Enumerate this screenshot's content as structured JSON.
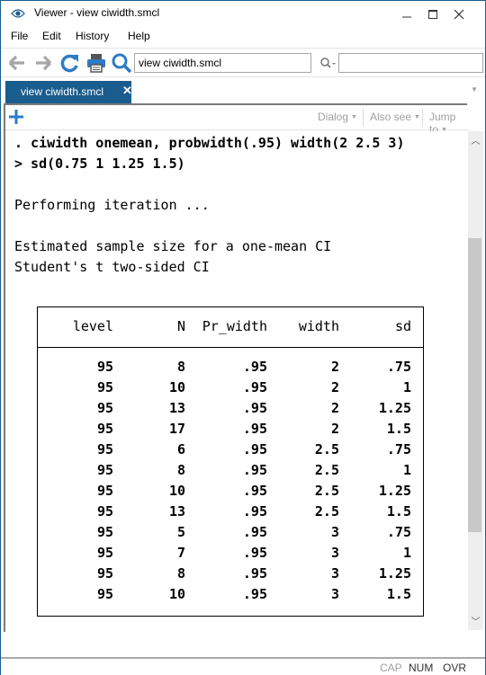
{
  "window": {
    "title": "Viewer - view ciwidth.smcl",
    "app_icon": "eye-icon",
    "controls": [
      "minimize",
      "maximize",
      "close"
    ]
  },
  "menu": {
    "items": [
      "File",
      "Edit",
      "History",
      "Help"
    ]
  },
  "toolbar": {
    "buttons": [
      {
        "name": "back",
        "icon": "arrow-left-icon",
        "enabled": false
      },
      {
        "name": "forward",
        "icon": "arrow-right-icon",
        "enabled": false
      },
      {
        "name": "refresh",
        "icon": "refresh-icon",
        "enabled": true
      },
      {
        "name": "print",
        "icon": "printer-icon",
        "enabled": true
      },
      {
        "name": "search",
        "icon": "magnifier-icon",
        "enabled": true
      }
    ],
    "command_value": "view ciwidth.smcl",
    "find_value": ""
  },
  "tabs": [
    {
      "label": "view ciwidth.smcl",
      "active": true,
      "close": "✕"
    }
  ],
  "subbar": {
    "dialog_label": "Dialog",
    "also_see_label": "Also see",
    "jump_to_label": "Jump to"
  },
  "content": {
    "command_line1": ". ciwidth onemean, probwidth(.95) width(2 2.5 3)",
    "command_line2": "> sd(0.75 1 1.25 1.5)",
    "iteration_text": "Performing iteration ...",
    "heading1": "Estimated sample size for a one-mean CI",
    "heading2": "Student's t two-sided CI",
    "table": {
      "columns": [
        "level",
        "N",
        "Pr_width",
        "width",
        "sd"
      ],
      "rows": [
        [
          "95",
          "8",
          ".95",
          "2",
          ".75"
        ],
        [
          "95",
          "10",
          ".95",
          "2",
          "1"
        ],
        [
          "95",
          "13",
          ".95",
          "2",
          "1.25"
        ],
        [
          "95",
          "17",
          ".95",
          "2",
          "1.5"
        ],
        [
          "95",
          "6",
          ".95",
          "2.5",
          ".75"
        ],
        [
          "95",
          "8",
          ".95",
          "2.5",
          "1"
        ],
        [
          "95",
          "10",
          ".95",
          "2.5",
          "1.25"
        ],
        [
          "95",
          "13",
          ".95",
          "2.5",
          "1.5"
        ],
        [
          "95",
          "5",
          ".95",
          "3",
          ".75"
        ],
        [
          "95",
          "7",
          ".95",
          "3",
          "1"
        ],
        [
          "95",
          "8",
          ".95",
          "3",
          "1.25"
        ],
        [
          "95",
          "10",
          ".95",
          "3",
          "1.5"
        ]
      ]
    }
  },
  "status": {
    "cap": "CAP",
    "num": "NUM",
    "ovr": "OVR"
  },
  "colors": {
    "accent": "#1b5c8e",
    "icon_blue": "#2e7bc4",
    "disabled": "#a0a0a0"
  }
}
